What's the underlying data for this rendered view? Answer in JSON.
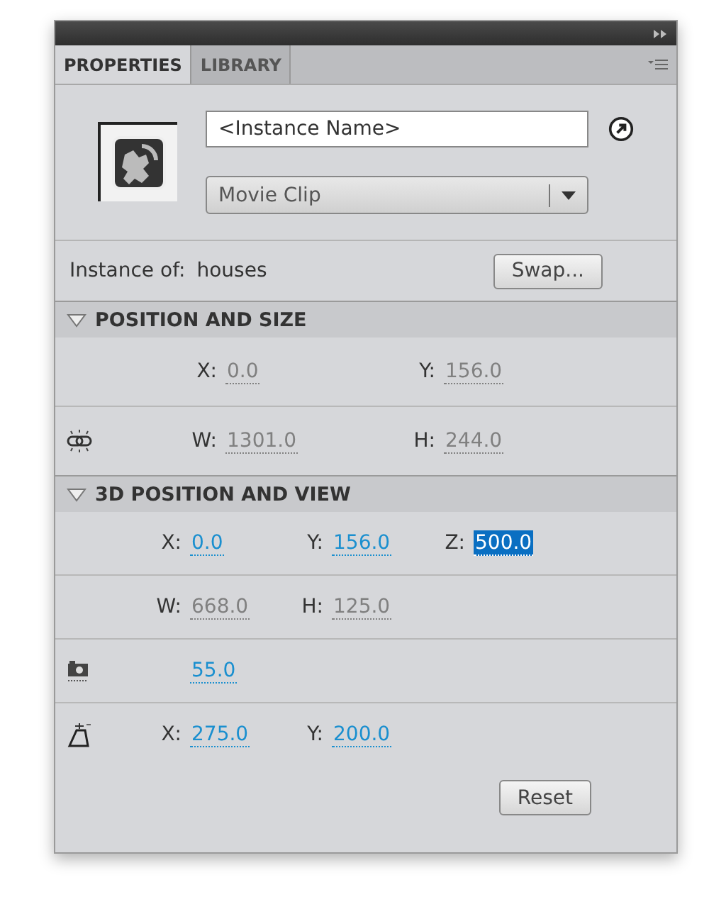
{
  "tabs": [
    {
      "label": "PROPERTIES",
      "selected": true
    },
    {
      "label": "LIBRARY",
      "selected": false
    }
  ],
  "instance_name": {
    "placeholder": "<Instance Name>"
  },
  "symbol_type": {
    "value": "Movie Clip"
  },
  "instance_of": {
    "label": "Instance of:",
    "value": "houses"
  },
  "swap_button": "Swap...",
  "sections": [
    {
      "title": "POSITION AND SIZE",
      "expanded": true,
      "rows": [
        {
          "fields": [
            {
              "label": "X:",
              "value": "0.0",
              "disabled": true,
              "selected": false
            },
            {
              "label": "Y:",
              "value": "156.0",
              "disabled": true,
              "selected": false
            }
          ]
        },
        {
          "kind": "link",
          "fields": [
            {
              "label": "W:",
              "value": "1301.0",
              "disabled": true,
              "selected": false
            },
            {
              "label": "H:",
              "value": "244.0",
              "disabled": true,
              "selected": false
            }
          ]
        }
      ]
    },
    {
      "title": "3D POSITION AND VIEW",
      "expanded": true,
      "rows": [
        {
          "fields": [
            {
              "label": "X:",
              "value": "0.0",
              "disabled": false,
              "selected": false
            },
            {
              "label": "Y:",
              "value": "156.0",
              "disabled": false,
              "selected": false
            },
            {
              "label": "Z:",
              "value": "500.0",
              "disabled": false,
              "selected": true
            }
          ]
        },
        {
          "fields": [
            {
              "label": "W:",
              "value": "668.0",
              "disabled": true,
              "selected": false
            },
            {
              "label": "H:",
              "value": "125.0",
              "disabled": true,
              "selected": false
            }
          ]
        },
        {
          "kind": "camera",
          "fields": [
            {
              "value": "55.0",
              "disabled": false,
              "selected": false
            }
          ]
        },
        {
          "kind": "vanishing",
          "fields": [
            {
              "label": "X:",
              "value": "275.0",
              "disabled": false,
              "selected": false
            },
            {
              "label": "Y:",
              "value": "200.0",
              "disabled": false,
              "selected": false
            }
          ]
        }
      ]
    }
  ],
  "reset_button": "Reset"
}
